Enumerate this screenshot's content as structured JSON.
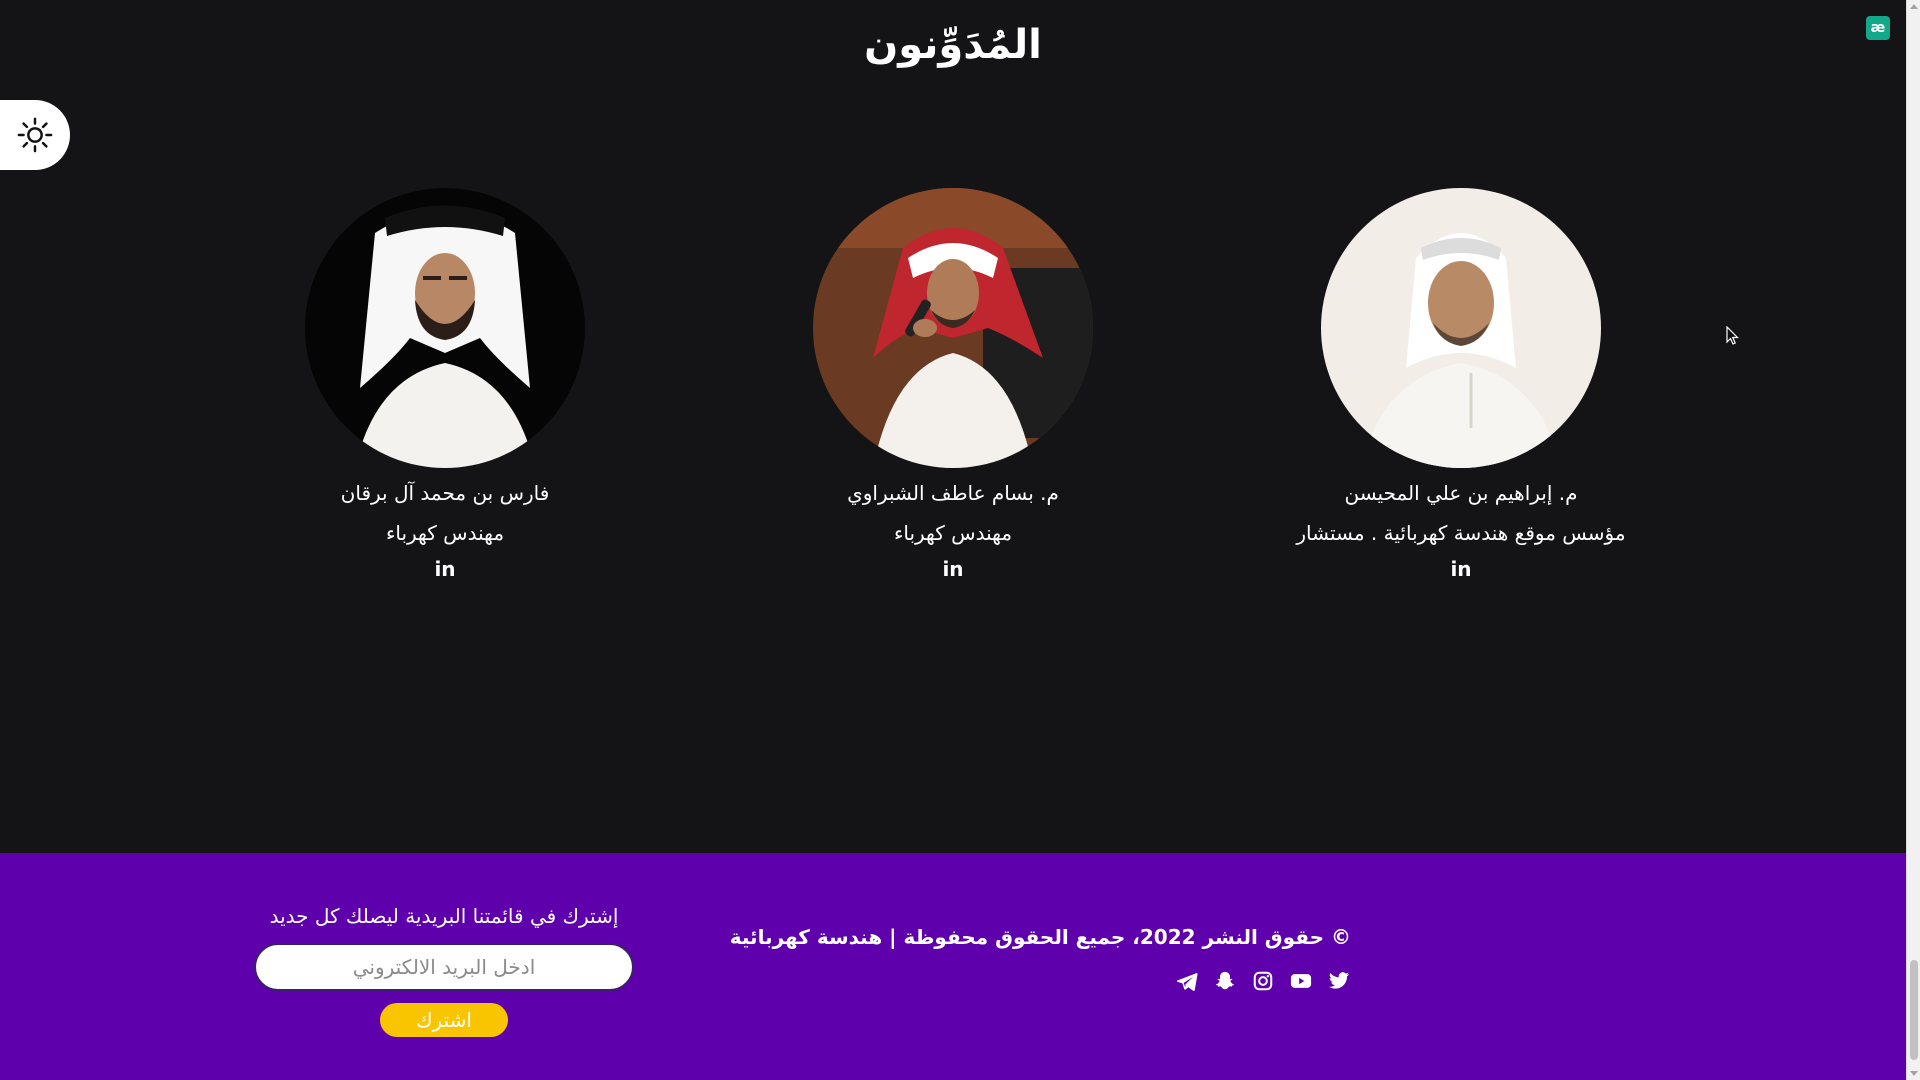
{
  "section": {
    "title": "المُدَوِّنون"
  },
  "theme_toggle": {
    "icon": "sun-icon"
  },
  "authors": [
    {
      "name": "م. إبراهيم بن علي المحيسن",
      "role": "مؤسس موقع هندسة كهربائية . مستشار",
      "linkedin": "in"
    },
    {
      "name": "م. بسام عاطف الشبراوي",
      "role": "مهندس كهرباء",
      "linkedin": "in"
    },
    {
      "name": "فارس بن محمد آل برقان",
      "role": "مهندس كهرباء",
      "linkedin": "in"
    }
  ],
  "footer": {
    "copyright": "© حقوق النشر 2022، جميع الحقوق محفوظة | هندسة كهربائية",
    "socials": [
      "twitter-icon",
      "youtube-icon",
      "instagram-icon",
      "snapchat-icon",
      "telegram-icon"
    ],
    "newsletter": {
      "title": "إشترك في قائمتنا البريدية ليصلك كل جديد",
      "placeholder": "ادخل البريد الالكتروني",
      "button": "اشترك"
    }
  },
  "colors": {
    "background": "#141416",
    "footer": "#5e00ab",
    "button": "#f9c400",
    "extension": "#14a88a"
  },
  "extension": {
    "label": "æ"
  }
}
